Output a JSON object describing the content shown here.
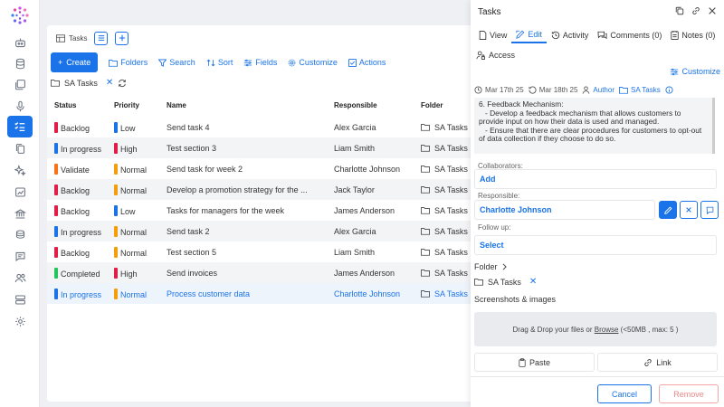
{
  "main": {
    "tab_label": "Tasks",
    "toolbar": {
      "create": "Create",
      "folders": "Folders",
      "search": "Search",
      "sort": "Sort",
      "fields": "Fields",
      "customize": "Customize",
      "actions": "Actions"
    },
    "filter": {
      "folder": "SA Tasks"
    },
    "columns": [
      "Status",
      "Priority",
      "Name",
      "Responsible",
      "Folder"
    ],
    "rows": [
      {
        "status": "Backlog",
        "status_color": "#e11d48",
        "priority": "Low",
        "priority_color": "#1a73e8",
        "name": "Send task 4",
        "responsible": "Alex Garcia",
        "folder": "SA Tasks"
      },
      {
        "status": "In progress",
        "status_color": "#1a73e8",
        "priority": "High",
        "priority_color": "#e11d48",
        "name": "Test section 3",
        "responsible": "Liam Smith",
        "folder": "SA Tasks"
      },
      {
        "status": "Validate",
        "status_color": "#f97316",
        "priority": "Normal",
        "priority_color": "#f59e0b",
        "name": "Send task for week 2",
        "responsible": "Charlotte Johnson",
        "folder": "SA Tasks"
      },
      {
        "status": "Backlog",
        "status_color": "#e11d48",
        "priority": "Normal",
        "priority_color": "#f59e0b",
        "name": "Develop a promotion strategy for the ...",
        "responsible": "Jack Taylor",
        "folder": "SA Tasks"
      },
      {
        "status": "Backlog",
        "status_color": "#e11d48",
        "priority": "Low",
        "priority_color": "#1a73e8",
        "name": "Tasks for managers for the week",
        "responsible": "James Anderson",
        "folder": "SA Tasks"
      },
      {
        "status": "In progress",
        "status_color": "#1a73e8",
        "priority": "Normal",
        "priority_color": "#f59e0b",
        "name": "Send task 2",
        "responsible": "Alex Garcia",
        "folder": "SA Tasks"
      },
      {
        "status": "Backlog",
        "status_color": "#e11d48",
        "priority": "Normal",
        "priority_color": "#f59e0b",
        "name": "Test section 5",
        "responsible": "Liam Smith",
        "folder": "SA Tasks"
      },
      {
        "status": "Completed",
        "status_color": "#22c55e",
        "priority": "High",
        "priority_color": "#e11d48",
        "name": "Send invoices",
        "responsible": "James Anderson",
        "folder": "SA Tasks"
      },
      {
        "status": "In progress",
        "status_color": "#1a73e8",
        "priority": "Normal",
        "priority_color": "#f59e0b",
        "name": "Process customer data",
        "responsible": "Charlotte Johnson",
        "folder": "SA Tasks"
      }
    ]
  },
  "drawer": {
    "title": "Tasks",
    "tabs": {
      "view": "View",
      "edit": "Edit",
      "activity": "Activity",
      "comments": "Comments (0)",
      "notes": "Notes (0)",
      "access": "Access"
    },
    "customize": "Customize",
    "meta": {
      "start": "Mar 17th 25",
      "end": "Mar 18th 25",
      "author": "Author",
      "folder": "SA Tasks"
    },
    "description": [
      "6. Feedback Mechanism:",
      "   - Develop a feedback mechanism that allows customers to provide input on how their data is used and managed.",
      "   - Ensure that there are clear procedures for customers to opt-out of data collection if they choose to do so."
    ],
    "collaborators_label": "Collaborators:",
    "collaborators_value": "Add",
    "responsible_label": "Responsible:",
    "responsible_value": "Charlotte Johnson",
    "followup_label": "Follow up:",
    "followup_value": "Select",
    "folder_heading": "Folder",
    "folder_value": "SA Tasks",
    "screenshots_label": "Screenshots & images",
    "dropzone": {
      "prefix": "Drag & Drop your files or ",
      "browse": "Browse",
      "suffix": " (<50MB , max: 5 )"
    },
    "paste": "Paste",
    "link": "Link",
    "cancel": "Cancel",
    "remove": "Remove"
  }
}
